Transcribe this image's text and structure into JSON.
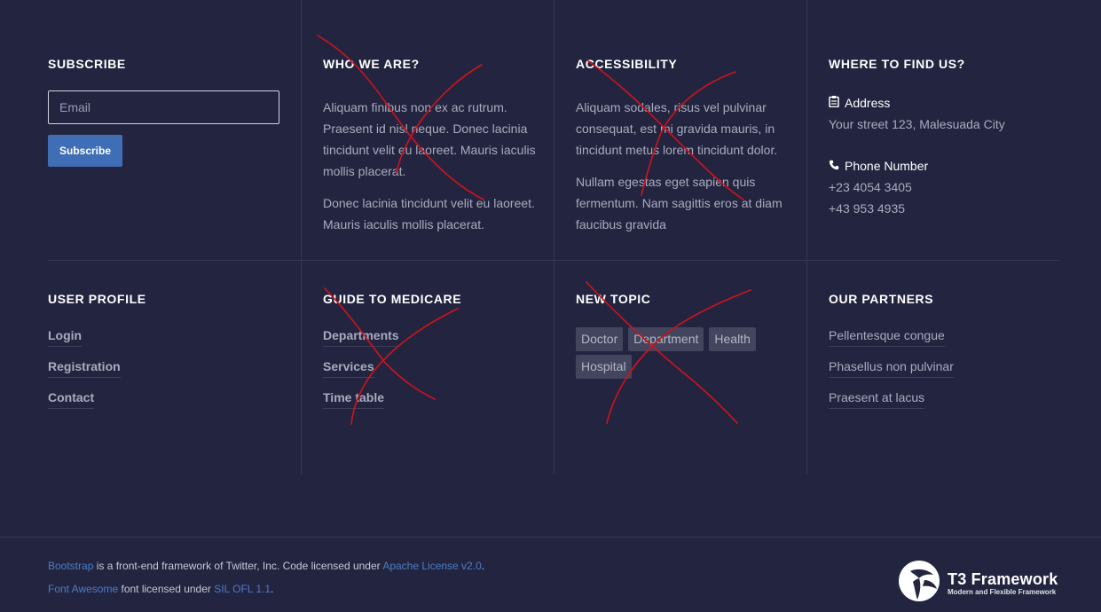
{
  "subscribe": {
    "heading": "SUBSCRIBE",
    "email_placeholder": "Email",
    "button_label": "Subscribe"
  },
  "who": {
    "heading": "WHO WE ARE?",
    "p1": "Aliquam finibus non ex ac rutrum. Praesent id nisl neque. Donec lacinia tincidunt velit eu laoreet. Mauris iaculis mollis placerat.",
    "p2": "Donec lacinia tincidunt velit eu laoreet. Mauris iaculis mollis placerat."
  },
  "accessibility": {
    "heading": "ACCESSIBILITY",
    "p1": "Aliquam sodales, risus vel pulvinar consequat, est mi gravida mauris, in tincidunt metus lorem tincidunt dolor.",
    "p2": "Nullam egestas eget sapien quis fermentum. Nam sagittis eros at diam faucibus gravida"
  },
  "find": {
    "heading": "WHERE TO FIND US?",
    "address_label": "Address",
    "address_icon": "address-card-icon",
    "address": "Your street 123, Malesuada City",
    "phone_label": "Phone Number",
    "phone_icon": "phone-icon",
    "phone1": "+23 4054 3405",
    "phone2": "+43 953 4935"
  },
  "user_profile": {
    "heading": "USER PROFILE",
    "items": [
      "Login",
      "Registration",
      "Contact"
    ]
  },
  "medicare": {
    "heading": "GUIDE TO MEDICARE",
    "items": [
      "Departments",
      "Services",
      "Time table"
    ]
  },
  "topic": {
    "heading": "NEW TOPIC",
    "tags": [
      "Doctor",
      "Department",
      "Health",
      "Hospital"
    ]
  },
  "partners": {
    "heading": "OUR PARTNERS",
    "items": [
      "Pellentesque congue",
      "Phasellus non pulvinar",
      "Praesent at lacus"
    ]
  },
  "footer": {
    "bootstrap_link": "Bootstrap",
    "line1_mid": " is a front-end framework of Twitter, Inc. Code licensed under ",
    "apache_link": "Apache License v2.0",
    "line1_end": ".",
    "fa_link": "Font Awesome",
    "line2_mid": " font licensed under ",
    "sil_link": "SIL OFL 1.1",
    "line2_end": "."
  },
  "logo": {
    "title": "T3 Framework",
    "tagline": "Modern and Flexible Framework"
  },
  "colors": {
    "background": "#232540",
    "accent": "#3f6eb5",
    "link": "#4d7bc6",
    "annotation": "#d0121b"
  }
}
